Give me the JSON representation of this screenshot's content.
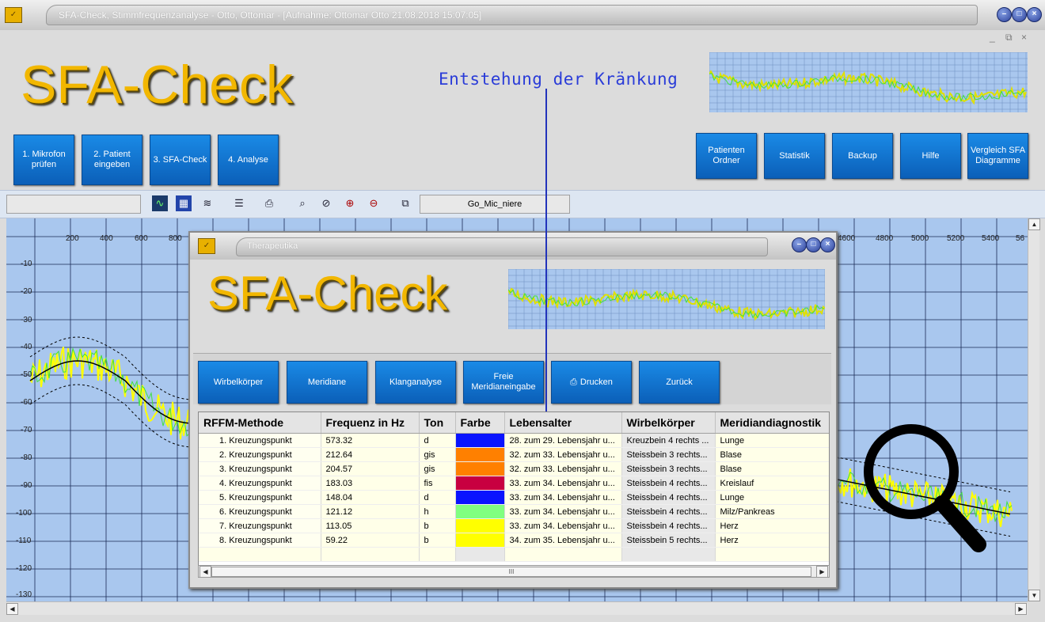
{
  "window": {
    "title": "SFA-Check, Stimmfrequenzanalyse - Otto, Ottomar - [Aufnahme: Ottomar Otto 21.08.2018 15:07:05]",
    "controls": [
      "_",
      "□",
      "×"
    ]
  },
  "logo": "SFA-Check",
  "annotation": "Entstehung der Kränkung",
  "nav_left": [
    {
      "label": "1. Mikrofon prüfen"
    },
    {
      "label": "2. Patient eingeben"
    },
    {
      "label": "3. SFA-Check"
    },
    {
      "label": "4. Analyse"
    }
  ],
  "nav_right": [
    {
      "label": "Patienten Ordner"
    },
    {
      "label": "Statistik"
    },
    {
      "label": "Backup"
    },
    {
      "label": "Hilfe"
    },
    {
      "label": "Vergleich SFA Diagramme"
    }
  ],
  "toolbar": {
    "left_field": "",
    "profile_field": "Go_Mic_niere",
    "icons": [
      "waveform-icon",
      "spectrum-icon",
      "layers-icon",
      "lines-icon",
      "print-icon",
      "zoom-icon",
      "zoom-reset-icon",
      "zoom-in-icon",
      "zoom-out-icon",
      "windows-icon"
    ]
  },
  "plot": {
    "x_ticks": [
      "200",
      "400",
      "600",
      "800",
      "4600",
      "4800",
      "5000",
      "5200",
      "5400",
      "56"
    ],
    "y_ticks": [
      "-10",
      "-20",
      "-30",
      "-40",
      "-50",
      "-60",
      "-70",
      "-80",
      "-90",
      "-100",
      "-110",
      "-120",
      "-130"
    ]
  },
  "dialog": {
    "title": "Therapeutika",
    "logo": "SFA-Check",
    "buttons": [
      "Wirbelkörper",
      "Meridiane",
      "Klanganalyse",
      "Freie Meridianeingabe",
      "Drucken",
      "Zurück"
    ],
    "columns": [
      "RFFM-Methode",
      "Frequenz in Hz",
      "Ton",
      "Farbe",
      "Lebensalter",
      "Wirbelkörper",
      "Meridiandiagnostik"
    ],
    "rows": [
      {
        "name": "1. Kreuzungspunkt",
        "freq": "573.32",
        "ton": "d",
        "color": "#0a14ff",
        "age": "28. zum 29. Lebensjahr u...",
        "wirbel": "Kreuzbein 4  rechts ...",
        "meridian": "Lunge"
      },
      {
        "name": "2. Kreuzungspunkt",
        "freq": "212.64",
        "ton": "gis",
        "color": "#ff8000",
        "age": "32. zum 33. Lebensjahr u...",
        "wirbel": "Steissbein 3  rechts...",
        "meridian": "Blase"
      },
      {
        "name": "3. Kreuzungspunkt",
        "freq": "204.57",
        "ton": "gis",
        "color": "#ff8000",
        "age": "32. zum 33. Lebensjahr u...",
        "wirbel": "Steissbein 3  rechts...",
        "meridian": "Blase"
      },
      {
        "name": "4. Kreuzungspunkt",
        "freq": "183.03",
        "ton": "fis",
        "color": "#c80040",
        "age": "33. zum 34. Lebensjahr u...",
        "wirbel": "Steissbein 4  rechts...",
        "meridian": "Kreislauf"
      },
      {
        "name": "5. Kreuzungspunkt",
        "freq": "148.04",
        "ton": "d",
        "color": "#0a14ff",
        "age": "33. zum 34. Lebensjahr u...",
        "wirbel": "Steissbein 4  rechts...",
        "meridian": "Lunge"
      },
      {
        "name": "6. Kreuzungspunkt",
        "freq": "121.12",
        "ton": "h",
        "color": "#80ff80",
        "age": "33. zum 34. Lebensjahr u...",
        "wirbel": "Steissbein 4  rechts...",
        "meridian": "Milz/Pankreas"
      },
      {
        "name": "7. Kreuzungspunkt",
        "freq": "113.05",
        "ton": "b",
        "color": "#ffff00",
        "age": "33. zum 34. Lebensjahr u...",
        "wirbel": "Steissbein 4  rechts...",
        "meridian": "Herz"
      },
      {
        "name": "8. Kreuzungspunkt",
        "freq": "59.22",
        "ton": "b",
        "color": "#ffff00",
        "age": "34. zum 35. Lebensjahr u...",
        "wirbel": "Steissbein 5  rechts...",
        "meridian": "Herz"
      }
    ],
    "scroll_thumb": "III"
  }
}
